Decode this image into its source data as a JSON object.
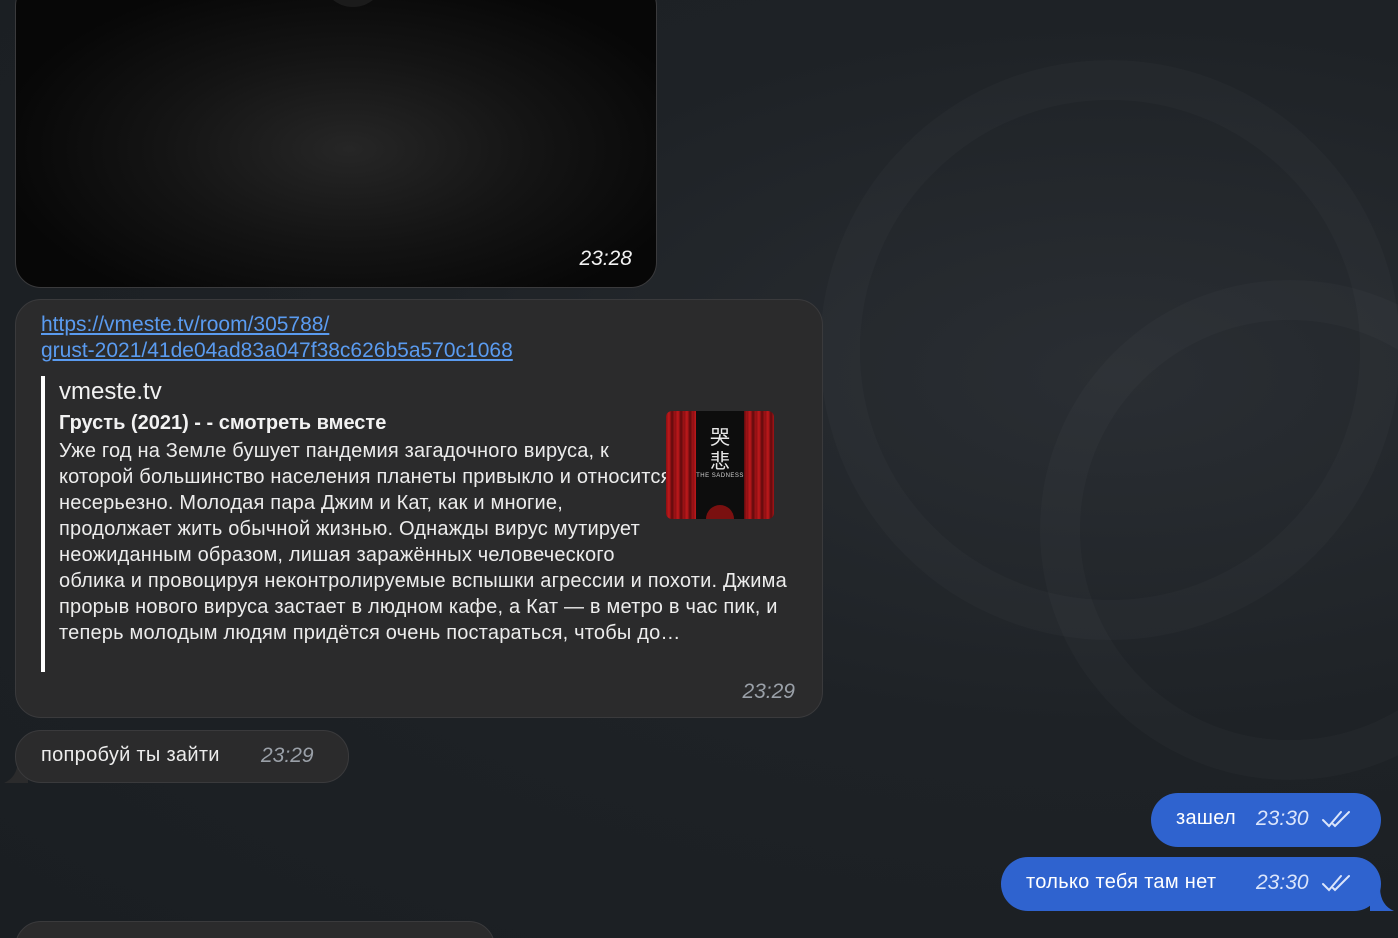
{
  "messages": {
    "video": {
      "time": "23:28"
    },
    "link": {
      "url_line1": "https://vmeste.tv/room/305788/",
      "url_line2": "grust-2021/41de04ad83a047f38c626b5a570c1068",
      "preview_site": "vmeste.tv",
      "preview_title": "Грусть (2021) -  - смотреть вместе",
      "preview_description": "Уже год на Земле бушует пандемия загадочного вируса, к которой большинство населения планеты привыкло и относится несерьезно. Молодая пара Джим и Кат, как и многие, продолжает жить обычной жизнью. Однажды вирус мутирует неожиданным образом, лишая заражённых человеческого облика и провоцируя неконтролируемые вспышки агрессии и похоти. Джима прорыв нового вируса застает в людном кафе, а Кат — в метро в час пик, и теперь молодым людям придётся очень постараться, чтобы до…",
      "poster_caption": "THE SADNESS",
      "time": "23:29"
    },
    "incoming_1": {
      "text": "попробуй ты зайти",
      "time": "23:29"
    },
    "outgoing_1": {
      "text": "зашел",
      "time": "23:30",
      "status_icon": "double-check-icon"
    },
    "outgoing_2": {
      "text": "только тебя там нет",
      "time": "23:30",
      "status_icon": "double-check-icon"
    }
  },
  "colors": {
    "background": "#1c2024",
    "incoming_bubble": "#2b2b2c",
    "outgoing_bubble": "#2f63cf",
    "link": "#5a9bf0"
  }
}
